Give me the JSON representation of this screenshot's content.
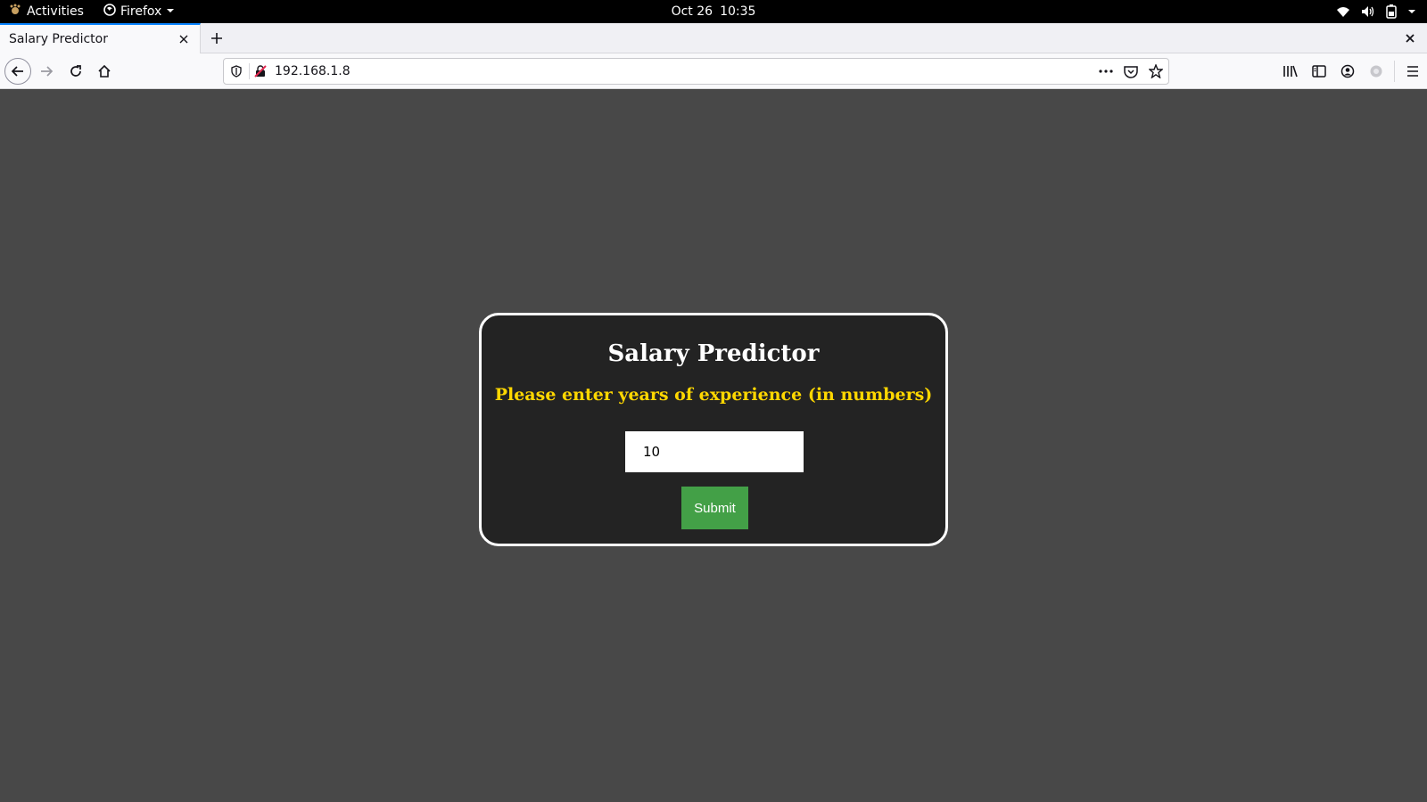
{
  "system_bar": {
    "activities": "Activities",
    "app_name": "Firefox",
    "date": "Oct 26",
    "time": "10:35"
  },
  "browser": {
    "tab_title": "Salary Predictor",
    "url": "192.168.1.8"
  },
  "page": {
    "title": "Salary Predictor",
    "subtitle": "Please enter years of experience (in numbers)",
    "experience_value": "10",
    "submit_label": "Submit"
  },
  "colors": {
    "page_background": "#484848",
    "card_background": "#232323",
    "card_border": "#ffffff",
    "subtitle_color": "#ffd700",
    "submit_background": "#43a047"
  }
}
